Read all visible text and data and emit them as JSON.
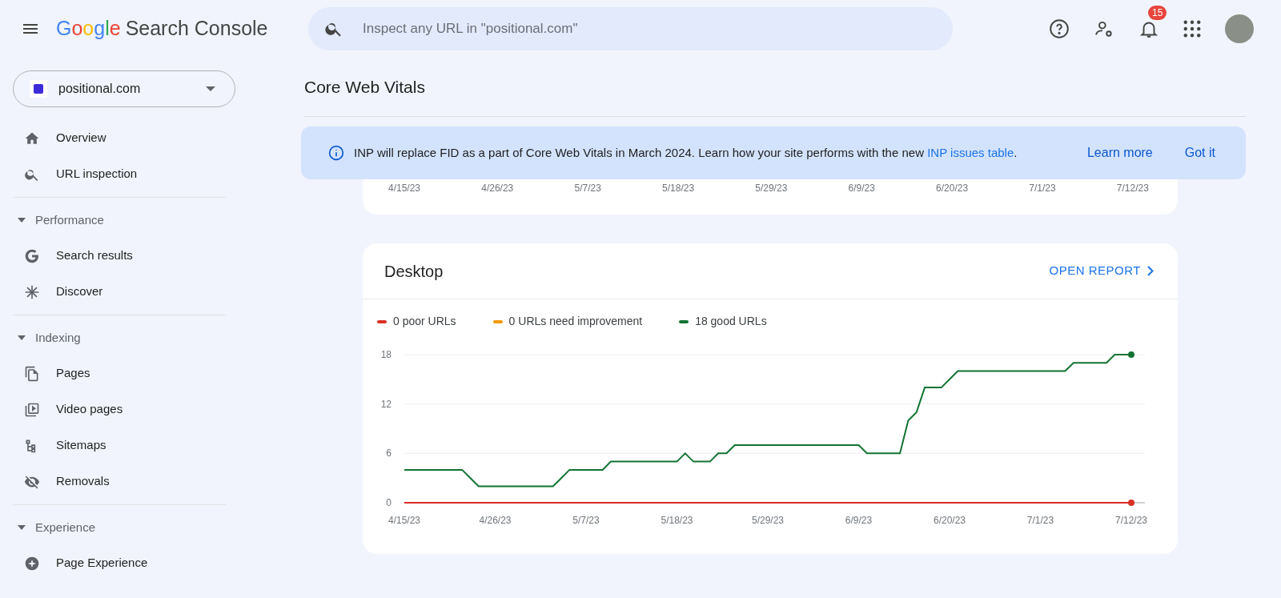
{
  "header": {
    "logo_text": "Google",
    "product": "Search Console",
    "search": {
      "placeholder": "Inspect any URL in \"positional.com\""
    },
    "notifications_count": "15"
  },
  "sidebar": {
    "property": "positional.com",
    "sections": [
      {
        "items": [
          {
            "label": "Overview"
          },
          {
            "label": "URL inspection"
          }
        ]
      },
      {
        "title": "Performance",
        "expanded": true,
        "items": [
          {
            "label": "Search results"
          },
          {
            "label": "Discover"
          }
        ]
      },
      {
        "title": "Indexing",
        "expanded": true,
        "items": [
          {
            "label": "Pages"
          },
          {
            "label": "Video pages"
          },
          {
            "label": "Sitemaps"
          },
          {
            "label": "Removals"
          }
        ]
      },
      {
        "title": "Experience",
        "expanded": true,
        "items": [
          {
            "label": "Page Experience"
          }
        ]
      }
    ]
  },
  "page_title": "Core Web Vitals",
  "banner": {
    "text_before": "INP will replace FID as a part of Core Web Vitals in March 2024. Learn how your site performs with the new ",
    "link": "INP issues table",
    "text_after": ".",
    "actions": [
      "Learn more",
      "Got it"
    ]
  },
  "upper_card": {
    "axis_labels": [
      "4/15/23",
      "4/26/23",
      "5/7/23",
      "5/18/23",
      "5/29/23",
      "6/9/23",
      "6/20/23",
      "7/1/23",
      "7/12/23"
    ]
  },
  "desktop_card": {
    "title": "Desktop",
    "action": "OPEN REPORT",
    "chart_data": {
      "type": "line",
      "categories": [
        "4/15/23",
        null,
        null,
        null,
        null,
        null,
        null,
        null,
        null,
        null,
        null,
        "4/26/23",
        null,
        null,
        null,
        null,
        null,
        null,
        null,
        null,
        null,
        null,
        "5/7/23",
        null,
        null,
        null,
        null,
        null,
        null,
        null,
        null,
        null,
        null,
        "5/18/23",
        null,
        null,
        null,
        null,
        null,
        null,
        null,
        null,
        null,
        null,
        "5/29/23",
        null,
        null,
        null,
        null,
        null,
        null,
        null,
        null,
        null,
        null,
        "6/9/23",
        null,
        null,
        null,
        null,
        null,
        null,
        null,
        null,
        null,
        null,
        "6/20/23",
        null,
        null,
        null,
        null,
        null,
        null,
        null,
        null,
        null,
        null,
        "7/1/23",
        null,
        null,
        null,
        null,
        null,
        null,
        null,
        null,
        null,
        null,
        "7/12/23"
      ],
      "series": [
        {
          "name": "0 poor URLs",
          "color": "#d93025",
          "values": [
            0,
            0,
            0,
            0,
            0,
            0,
            0,
            0,
            0,
            0,
            0,
            0,
            0,
            0,
            0,
            0,
            0,
            0,
            0,
            0,
            0,
            0,
            0,
            0,
            0,
            0,
            0,
            0,
            0,
            0,
            0,
            0,
            0,
            0,
            0,
            0,
            0,
            0,
            0,
            0,
            0,
            0,
            0,
            0,
            0,
            0,
            0,
            0,
            0,
            0,
            0,
            0,
            0,
            0,
            0,
            0,
            0,
            0,
            0,
            0,
            0,
            0,
            0,
            0,
            0,
            0,
            0,
            0,
            0,
            0,
            0,
            0,
            0,
            0,
            0,
            0,
            0,
            0,
            0,
            0,
            0,
            0,
            0,
            0,
            0,
            0,
            0,
            0,
            0
          ]
        },
        {
          "name": "0 URLs need improvement",
          "color": "#f29900",
          "values": [
            null,
            null,
            null,
            null,
            null,
            null,
            null,
            null,
            null,
            null,
            null,
            null,
            null,
            null,
            null,
            null,
            null,
            null,
            null,
            null,
            null,
            null,
            null,
            null,
            null,
            null,
            null,
            null,
            null,
            null,
            null,
            null,
            null,
            null,
            null,
            null,
            null,
            null,
            null,
            null,
            null,
            null,
            null,
            null,
            null,
            null,
            null,
            null,
            null,
            null,
            null,
            null,
            null,
            null,
            null,
            null,
            null,
            null,
            null,
            null,
            null,
            null,
            null,
            null,
            null,
            null,
            null,
            null,
            null,
            null,
            null,
            null,
            null,
            null,
            null,
            null,
            null,
            null,
            null,
            null,
            null,
            null,
            null,
            null,
            null,
            null,
            null,
            null,
            null
          ]
        },
        {
          "name": "18 good URLs",
          "color": "#137333",
          "values": [
            4,
            4,
            4,
            4,
            4,
            4,
            4,
            4,
            3,
            2,
            2,
            2,
            2,
            2,
            2,
            2,
            2,
            2,
            2,
            3,
            4,
            4,
            4,
            4,
            4,
            5,
            5,
            5,
            5,
            5,
            5,
            5,
            5,
            5,
            6,
            5,
            5,
            5,
            6,
            6,
            7,
            7,
            7,
            7,
            7,
            7,
            7,
            7,
            7,
            7,
            7,
            7,
            7,
            7,
            7,
            7,
            6,
            6,
            6,
            6,
            6,
            10,
            11,
            14,
            14,
            14,
            15,
            16,
            16,
            16,
            16,
            16,
            16,
            16,
            16,
            16,
            16,
            16,
            16,
            16,
            16,
            17,
            17,
            17,
            17,
            17,
            18,
            18,
            18
          ]
        }
      ],
      "ylim": [
        0,
        18
      ],
      "yticks": [
        0,
        6,
        12,
        18
      ]
    }
  }
}
